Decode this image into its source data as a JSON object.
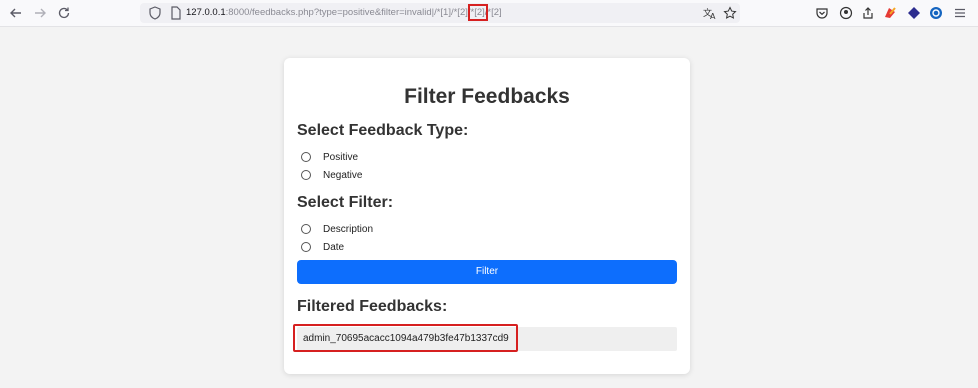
{
  "browser": {
    "url": {
      "host": "127.0.0.1",
      "rest": ":8000/feedbacks.php?type=positive&filter=invalid|/*[1]/*[2]/",
      "highlighted": "*[2]",
      "tail": "/*[2]"
    },
    "icons": {
      "back": "back-arrow-icon",
      "forward": "forward-arrow-icon",
      "reload": "reload-icon",
      "shield": "shield-icon",
      "page": "page-icon",
      "translate": "translate-icon",
      "bookmark": "star-icon",
      "pocket": "pocket-icon",
      "account": "account-icon",
      "share": "share-icon",
      "ext1": "extension-icon",
      "ext2": "extension-icon",
      "ext3": "extension-icon",
      "menu": "menu-icon"
    },
    "highlight_color": "#d62020"
  },
  "card": {
    "title": "Filter Feedbacks",
    "type_heading": "Select Feedback Type:",
    "type_options": [
      "Positive",
      "Negative"
    ],
    "filter_heading": "Select Filter:",
    "filter_options": [
      "Description",
      "Date"
    ],
    "button_label": "Filter",
    "button_color": "#0d6efd",
    "results_heading": "Filtered Feedbacks:",
    "result_value": "admin_70695acacc1094a479b3fe47b1337cd9"
  }
}
